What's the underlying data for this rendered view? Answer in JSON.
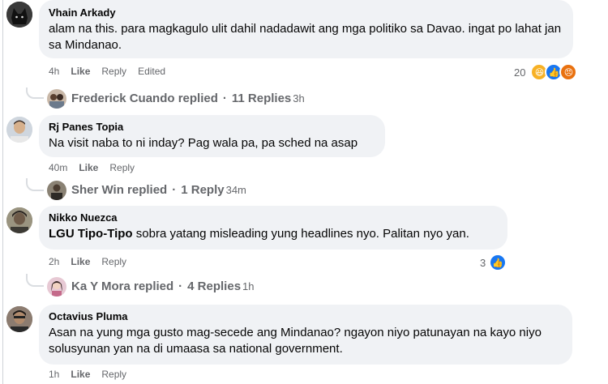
{
  "comments": [
    {
      "author": "Vhain Arkady",
      "text": "alam na this. para magkagulo ulit dahil nadadawit ang mga politiko sa Davao. ingat po lahat jan sa Mindanao.",
      "time": "4h",
      "like": "Like",
      "reply": "Reply",
      "edited": "Edited",
      "reaction_count": "20",
      "reactions": [
        "haha",
        "like",
        "angry"
      ],
      "replies_by": "Frederick Cuando replied",
      "replies_sep": "·",
      "replies_count": "11 Replies",
      "replies_time": "3h"
    },
    {
      "author": "Rj Panes Topia",
      "text": "Na visit naba to ni inday? Pag wala pa, pa sched na asap",
      "time": "40m",
      "like": "Like",
      "reply": "Reply",
      "replies_by": "Sher Win replied",
      "replies_sep": "·",
      "replies_count": "1 Reply",
      "replies_time": "34m"
    },
    {
      "author": "Nikko Nuezca",
      "mention": "LGU Tipo-Tipo",
      "text": " sobra yatang misleading yung headlines nyo. Palitan nyo yan.",
      "time": "2h",
      "like": "Like",
      "reply": "Reply",
      "reaction_count": "3",
      "reactions": [
        "like"
      ],
      "replies_by": "Ka Y Mora replied",
      "replies_sep": "·",
      "replies_count": "4 Replies",
      "replies_time": "1h"
    },
    {
      "author": "Octavius Pluma",
      "text": "Asan na yung mga gusto mag-secede ang Mindanao? ngayon niyo patunayan na kayo niyo solusyunan yan na di umaasa sa national government.",
      "time": "1h",
      "like": "Like",
      "reply": "Reply"
    }
  ],
  "colors": {
    "bubble": "#f0f2f5",
    "meta_text": "#65676b",
    "like_blue": "#1877f2",
    "haha_yellow": "#f7b125",
    "angry_red": "#e9710f"
  }
}
